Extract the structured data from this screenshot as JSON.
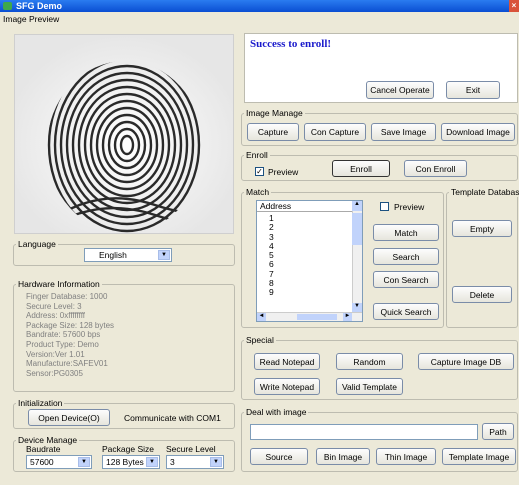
{
  "window": {
    "title": "SFG Demo",
    "close_glyph": "×"
  },
  "preview": {
    "label": "Image Preview"
  },
  "message": {
    "text": "Success to enroll!",
    "color": "#1a1acc"
  },
  "top_buttons": {
    "cancel": "Cancel Operate",
    "exit": "Exit"
  },
  "image_manage": {
    "label": "Image Manage",
    "capture": "Capture",
    "con_capture": "Con Capture",
    "save_image": "Save Image",
    "download_image": "Download Image"
  },
  "enroll": {
    "label": "Enroll",
    "preview_check": "Preview",
    "preview_checked": true,
    "check_glyph": "✓",
    "enroll_btn": "Enroll",
    "con_enroll_btn": "Con Enroll"
  },
  "match": {
    "label": "Match",
    "list_header": "Address",
    "addresses": [
      "1",
      "2",
      "3",
      "4",
      "5",
      "6",
      "7",
      "8",
      "9"
    ],
    "preview_check": "Preview",
    "match_btn": "Match",
    "search_btn": "Search",
    "con_search_btn": "Con Search",
    "quick_search_btn": "Quick Search"
  },
  "template_db": {
    "label": "Template Databas",
    "empty_btn": "Empty",
    "delete_btn": "Delete"
  },
  "language": {
    "label": "Language",
    "value": "English"
  },
  "hardware": {
    "label": "Hardware Information",
    "lines": [
      "Finger Database: 1000",
      "Secure Level: 3",
      "Address: 0xffffffff",
      "Package Size: 128 bytes",
      "Bandrate: 57600 bps",
      "Product Type:  Demo",
      "Version:Ver 1.01",
      "Manufacture:SAFEV01",
      "Sensor:PG0305"
    ]
  },
  "special": {
    "label": "Special",
    "read_notepad": "Read Notepad",
    "random": "Random",
    "capture_db": "Capture Image DB",
    "write_notepad": "Write Notepad",
    "valid_template": "Valid Template"
  },
  "initialization": {
    "label": "Initialization",
    "open_device": "Open Device(O)",
    "status": "Communicate with COM1"
  },
  "device_manage": {
    "label": "Device Manage",
    "baudrate_label": "Baudrate",
    "baudrate_value": "57600",
    "package_label": "Package Size",
    "package_value": "128 Bytes",
    "secure_label": "Secure Level",
    "secure_value": "3"
  },
  "deal": {
    "label": "Deal with image",
    "path_btn": "Path",
    "source": "Source",
    "bin_image": "Bin Image",
    "thin_image": "Thin Image",
    "template_image": "Template Image"
  }
}
